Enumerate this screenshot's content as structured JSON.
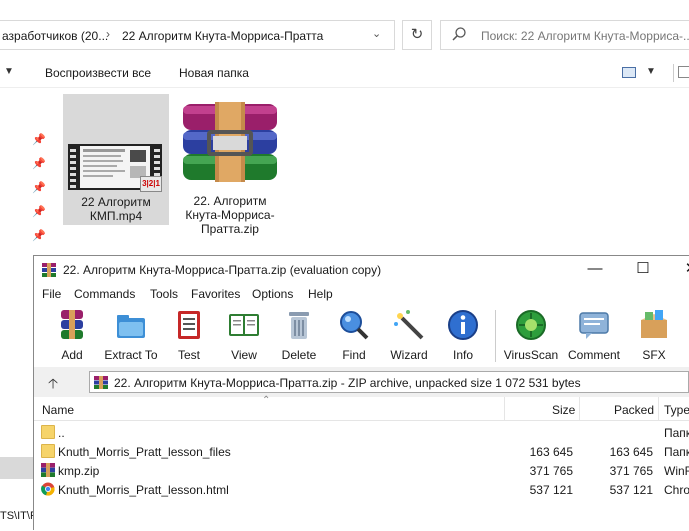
{
  "explorer": {
    "breadcrumb": [
      "азработчиков (20...",
      "22 Алгоритм Кнута-Морриса-Пратта"
    ],
    "breadcrumb_separator": "›",
    "search_placeholder": "Поиск: 22 Алгоритм Кнута-Морриса-...",
    "toolbar": {
      "play_all": "Воспроизвести все",
      "new_folder": "Новая папка"
    },
    "files": [
      {
        "name": "22 Алгоритм КМП.mp4",
        "icon": "video-thumbnail"
      },
      {
        "name": "22. Алгоритм Кнута-Морриса-Пратта.zip",
        "icon": "winrar-archive-icon"
      }
    ],
    "nav_path_fragment": "TS\\IT\\F"
  },
  "winrar": {
    "title": "22. Алгоритм Кнута-Морриса-Пратта.zip (evaluation copy)",
    "window_buttons": {
      "minimize": "—",
      "maximize": "☐",
      "close": "✕"
    },
    "menu": [
      "File",
      "Commands",
      "Tools",
      "Favorites",
      "Options",
      "Help"
    ],
    "tools": [
      {
        "label": "Add",
        "icon": "add-archive-icon"
      },
      {
        "label": "Extract To",
        "icon": "extract-folder-icon"
      },
      {
        "label": "Test",
        "icon": "test-checklist-icon"
      },
      {
        "label": "View",
        "icon": "view-book-icon"
      },
      {
        "label": "Delete",
        "icon": "trash-icon"
      },
      {
        "label": "Find",
        "icon": "magnifier-icon"
      },
      {
        "label": "Wizard",
        "icon": "magic-wand-icon"
      },
      {
        "label": "Info",
        "icon": "info-icon"
      },
      {
        "label": "VirusScan",
        "icon": "virus-scan-icon"
      },
      {
        "label": "Comment",
        "icon": "comment-icon"
      },
      {
        "label": "SFX",
        "icon": "sfx-box-icon"
      }
    ],
    "path": "22. Алгоритм Кнута-Морриса-Пратта.zip - ZIP archive, unpacked size 1 072 531 bytes",
    "columns": {
      "name": "Name",
      "size": "Size",
      "packed": "Packed",
      "type": "Type"
    },
    "rows": [
      {
        "name": "..",
        "size": "",
        "packed": "",
        "type": "Папк",
        "icon": "folder-up-icon"
      },
      {
        "name": "Knuth_Morris_Pratt_lesson_files",
        "size": "163 645",
        "packed": "163 645",
        "type": "Папк",
        "icon": "folder-icon"
      },
      {
        "name": "kmp.zip",
        "size": "371 765",
        "packed": "371 765",
        "type": "WinF",
        "icon": "winrar-file-icon"
      },
      {
        "name": "Knuth_Morris_Pratt_lesson.html",
        "size": "537 121",
        "packed": "537 121",
        "type": "Chro",
        "icon": "chrome-icon"
      }
    ]
  }
}
